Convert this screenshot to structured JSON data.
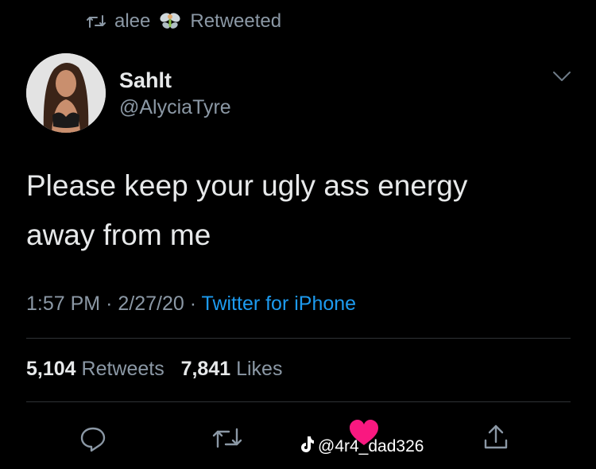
{
  "retweet_banner": {
    "user": "alee",
    "emoji": "fairy-emoji",
    "label": "Retweeted"
  },
  "author": {
    "name": "Sahlt",
    "handle": "@AlyciaTyre"
  },
  "tweet": {
    "text_line1": "Please keep your ugly ass energy",
    "text_line2": "away from me",
    "time": "1:57 PM",
    "date": "2/27/20",
    "separator": "·",
    "source": "Twitter for iPhone"
  },
  "stats": {
    "retweets_count": "5,104",
    "retweets_label": "Retweets",
    "likes_count": "7,841",
    "likes_label": "Likes"
  },
  "actions": [
    "reply-icon",
    "retweet-icon",
    "like-icon",
    "share-icon"
  ],
  "watermark": {
    "text": "@4r4_dad326",
    "logo": "tiktok-logo"
  },
  "colors": {
    "background": "#000000",
    "link": "#1d9bf0",
    "muted": "#8b98a5",
    "text": "#e7e9ea",
    "like": "#f91880"
  }
}
